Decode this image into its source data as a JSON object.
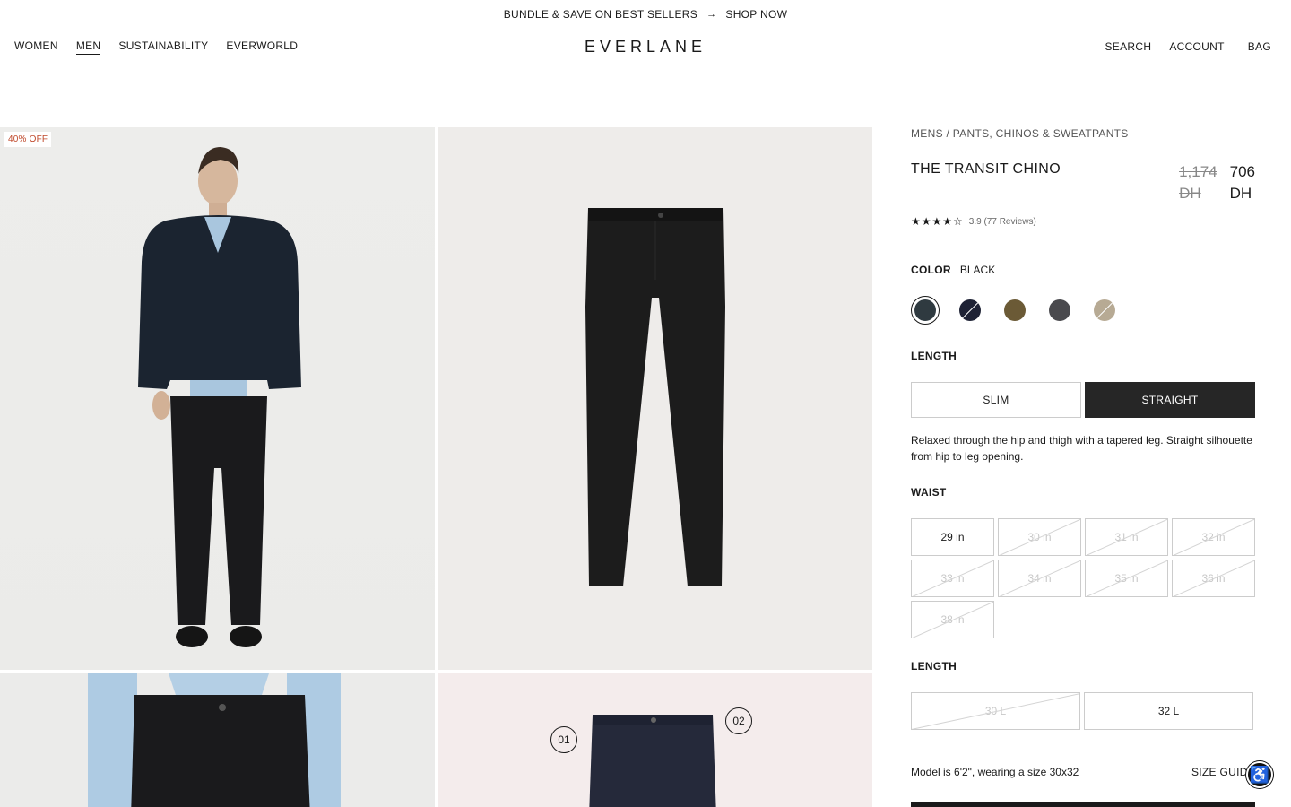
{
  "promo": {
    "text": "BUNDLE & SAVE ON BEST SELLERS",
    "arrow": "→",
    "cta": "SHOP NOW"
  },
  "nav": {
    "left": [
      "WOMEN",
      "MEN",
      "SUSTAINABILITY",
      "EVERWORLD"
    ],
    "active": "MEN",
    "logo": "EVERLANE",
    "right": [
      "SEARCH",
      "ACCOUNT",
      "BAG"
    ]
  },
  "gallery": {
    "badge": "40% OFF",
    "callouts": [
      "01",
      "02"
    ]
  },
  "product": {
    "breadcrumb": "MENS / PANTS, CHINOS & SWEATPANTS",
    "title": "THE TRANSIT CHINO",
    "price_old": "1,174",
    "price_old_currency": "DH",
    "price_new": "706",
    "price_new_currency": "DH",
    "stars": "★★★★☆",
    "rating_text": "3.9 (77 Reviews)",
    "rating_value": 3.9,
    "color_label": "COLOR",
    "color_value": "BLACK",
    "swatches": [
      {
        "name": "black",
        "hex": "#2f3a40",
        "selected": true,
        "available": true
      },
      {
        "name": "navy",
        "hex": "#1e2235",
        "selected": false,
        "available": false
      },
      {
        "name": "olive",
        "hex": "#6b5a36",
        "selected": false,
        "available": true
      },
      {
        "name": "charcoal",
        "hex": "#4a4a4e",
        "selected": false,
        "available": true
      },
      {
        "name": "khaki",
        "hex": "#b7aa94",
        "selected": false,
        "available": false
      }
    ],
    "length_fit_label": "LENGTH",
    "fits": [
      "SLIM",
      "STRAIGHT"
    ],
    "fit_selected": "STRAIGHT",
    "fit_description": "Relaxed through the hip and thigh with a tapered leg. Straight silhouette from hip to leg opening.",
    "waist_label": "WAIST",
    "waist_sizes": [
      {
        "label": "29 in",
        "available": true
      },
      {
        "label": "30 in",
        "available": false
      },
      {
        "label": "31 in",
        "available": false
      },
      {
        "label": "32 in",
        "available": false
      },
      {
        "label": "33 in",
        "available": false
      },
      {
        "label": "34 in",
        "available": false
      },
      {
        "label": "35 in",
        "available": false
      },
      {
        "label": "36 in",
        "available": false
      },
      {
        "label": "38 in",
        "available": false
      }
    ],
    "length_label": "LENGTH",
    "length_sizes": [
      {
        "label": "30 L",
        "available": false
      },
      {
        "label": "32 L",
        "available": true
      }
    ],
    "model_text": "Model is 6'2\", wearing a size 30x32",
    "size_guide": "SIZE GUIDE"
  }
}
